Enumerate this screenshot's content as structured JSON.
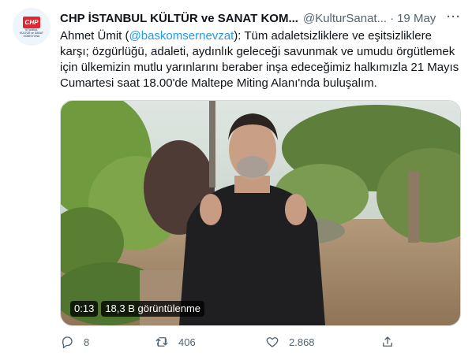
{
  "author": {
    "display_name": "CHP İSTANBUL KÜLTÜR ve SANAT KOM...",
    "handle": "@KulturSanat...",
    "date": "19 May",
    "avatar": {
      "logo_text": "CHP",
      "lines": [
        "İSTANBUL",
        "KÜLTÜR ve SANAT",
        "KOMİSYONU"
      ],
      "logo_color": "#e3262f"
    }
  },
  "tweet": {
    "text_before": "Ahmet Ümit (",
    "mention": "@baskomsernevzat",
    "text_after": "): Tüm adaletsizliklere ve eşitsizliklere karşı; özgürlüğü, adaleti, aydınlık geleceği savunmak ve umudu örgütlemek için ülkemizin mutlu yarınlarını beraber inşa edeceğimiz halkımızla 21 Mayıs Cumartesi saat 18.00'de Maltepe Miting Alanı'nda buluşalım.",
    "link_color": "#1d9bf0"
  },
  "video": {
    "timestamp": "0:13",
    "views": "18,3 B görüntülenme"
  },
  "actions": {
    "reply_count": "8",
    "retweet_count": "406",
    "like_count": "2.868"
  },
  "icons": {
    "more": "more-icon",
    "reply": "reply-icon",
    "retweet": "retweet-icon",
    "like": "like-icon",
    "share": "share-icon"
  }
}
